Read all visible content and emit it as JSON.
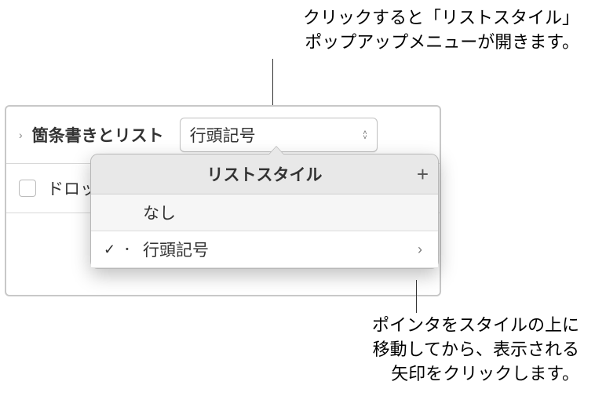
{
  "callouts": {
    "top": {
      "line1": "クリックすると「リストスタイル」",
      "line2": "ポップアップメニューが開きます。"
    },
    "bottom": {
      "line1": "ポインタをスタイルの上に",
      "line2": "移動してから、表示される",
      "line3": "矢印をクリックします。"
    }
  },
  "panel": {
    "sectionLabel": "箇条書きとリスト",
    "popupValue": "行頭記号",
    "dropCapPartial": "ドロッ"
  },
  "popover": {
    "title": "リストスタイル",
    "addIcon": "+",
    "items": [
      {
        "label": "なし",
        "selected": false,
        "hasArrow": false
      },
      {
        "label": "行頭記号",
        "selected": true,
        "hasArrow": true
      }
    ]
  },
  "icons": {
    "checkmark": "✓",
    "bullet": "•",
    "chevronRight": "›",
    "chevronUp": "˄",
    "chevronDown": "˅",
    "disclosureRight": "›"
  }
}
